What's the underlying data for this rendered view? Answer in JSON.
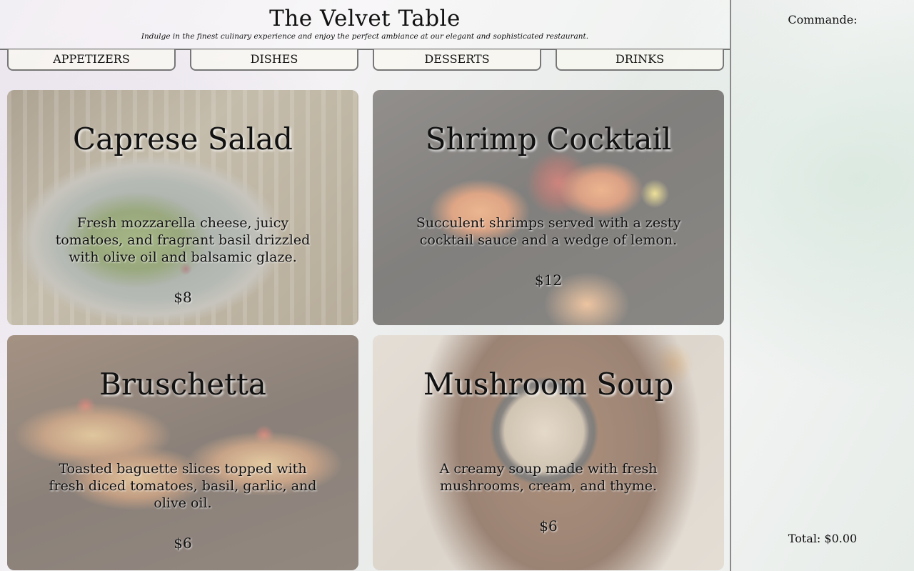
{
  "header": {
    "title": "The Velvet Table",
    "tagline": "Indulge in the finest culinary experience and enjoy the perfect ambiance at our elegant and sophisticated restaurant."
  },
  "tabs": [
    {
      "label": "APPETIZERS"
    },
    {
      "label": "DISHES"
    },
    {
      "label": "DESSERTS"
    },
    {
      "label": "DRINKS"
    }
  ],
  "menu": {
    "items": [
      {
        "name": "Caprese Salad",
        "description": "Fresh mozzarella cheese, juicy tomatoes, and fragrant basil drizzled with olive oil and balsamic glaze.",
        "price": "$8"
      },
      {
        "name": "Shrimp Cocktail",
        "description": "Succulent shrimps served with a zesty cocktail sauce and a wedge of lemon.",
        "price": "$12"
      },
      {
        "name": "Bruschetta",
        "description": "Toasted baguette slices topped with fresh diced tomatoes, basil, garlic, and olive oil.",
        "price": "$6"
      },
      {
        "name": "Mushroom Soup",
        "description": "A creamy soup made with fresh mushrooms, cream, and thyme.",
        "price": "$6"
      }
    ]
  },
  "order": {
    "label": "Commande:",
    "total": "Total: $0.00"
  }
}
